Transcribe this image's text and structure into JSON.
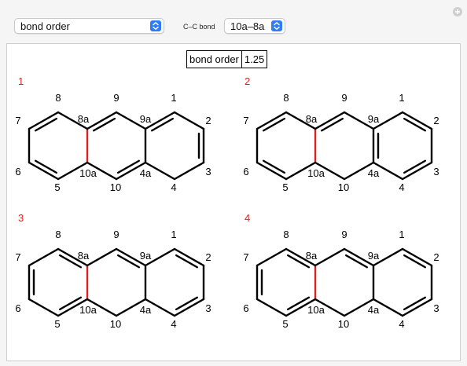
{
  "controls": {
    "measure_select": {
      "value": "bond order"
    },
    "bond_label": "C–C bond",
    "bond_select": {
      "value": "10a–8a"
    }
  },
  "result_table": {
    "label": "bond order",
    "value": "1.25"
  },
  "structures": [
    {
      "number": "1"
    },
    {
      "number": "2"
    },
    {
      "number": "3"
    },
    {
      "number": "4"
    }
  ],
  "atom_labels": {
    "8": "8",
    "9": "9",
    "1": "1",
    "7": "7",
    "8a": "8a",
    "9a": "9a",
    "2": "2",
    "6": "6",
    "10a": "10a",
    "4a": "4a",
    "3": "3",
    "5": "5",
    "10": "10",
    "4": "4"
  },
  "colors": {
    "highlight_bond": "#e0201f",
    "structure_number": "#e0201f",
    "select_button": "#2f7cf6"
  }
}
